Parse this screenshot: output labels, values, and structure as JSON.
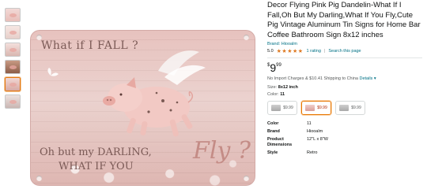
{
  "product": {
    "title": "Decor Flying Pink Pig Dandelin-What If I Fall,Oh But My Darling,What If You Fly,Cute Pig Vintage Aluminum Tin Signs for Home Bar Coffee Bathroom Sign 8x12 inches",
    "brand_link": "Brand: Hiooalm",
    "rating": "5.0",
    "stars": "★★★★★",
    "rating_count": "1 rating",
    "search_link": "Search this page",
    "price_symbol": "$",
    "price_whole": "9",
    "price_fraction": "99",
    "import_text": "No Import Charges & $10.41 Shipping to China",
    "details_link": "Details",
    "size_label": "Size:",
    "size_value": "8x12 inch",
    "color_label": "Color:",
    "color_value": "11",
    "swatches": [
      {
        "price": "$9.99"
      },
      {
        "price": "$9.99"
      },
      {
        "price": "$9.99"
      }
    ],
    "specs": [
      {
        "key": "Color",
        "value": "11"
      },
      {
        "key": "Brand",
        "value": "Hiooalm"
      },
      {
        "key": "Product Dimensions",
        "value": "12\"L x 8\"W"
      },
      {
        "key": "Style",
        "value": "Retro"
      }
    ]
  },
  "sign": {
    "top_text": "What if I FALL ?",
    "bottom_line1": "Oh but my DARLING,",
    "bottom_line2": "WHAT IF YOU",
    "fly_text": "Fly ?"
  },
  "colors": {
    "accent_orange": "#e77600",
    "link_teal": "#007185",
    "star": "#de7921",
    "sign_pink": "#e6bfbb"
  }
}
